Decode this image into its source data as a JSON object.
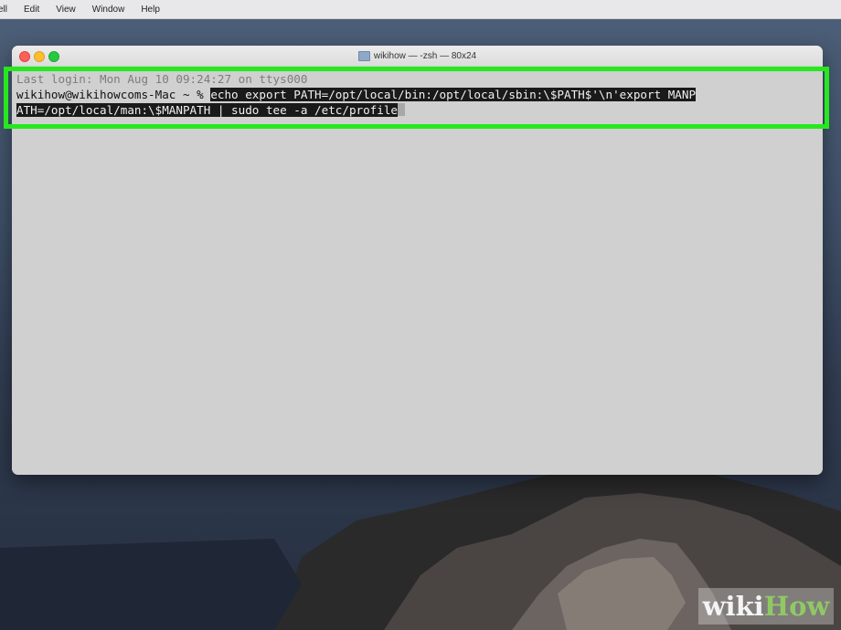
{
  "menubar": {
    "items": [
      "ell",
      "Edit",
      "View",
      "Window",
      "Help"
    ]
  },
  "window": {
    "title": "wikihow — -zsh — 80x24"
  },
  "terminal": {
    "last_login": "Last login: Mon Aug 10 09:24:27 on ttys000",
    "prompt": "wikihow@wikihowcoms-Mac ~ % ",
    "command_line1": "echo export PATH=/opt/local/bin:/opt/local/sbin:\\$PATH$'\\n'export MANP",
    "command_line2": "ATH=/opt/local/man:\\$MANPATH | sudo tee -a /etc/profile"
  },
  "watermark": {
    "wiki": "wiki",
    "how": "How"
  },
  "colors": {
    "highlight": "#26e81f",
    "terminal_bg": "#d0d0d0",
    "selection_bg": "#1a1a1a",
    "watermark_how": "#8fc965"
  }
}
